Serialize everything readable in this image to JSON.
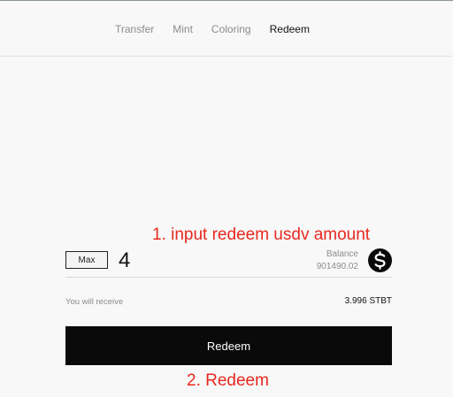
{
  "nav": {
    "items": [
      {
        "label": "Transfer",
        "active": false
      },
      {
        "label": "Mint",
        "active": false
      },
      {
        "label": "Coloring",
        "active": false
      },
      {
        "label": "Redeem",
        "active": true
      }
    ]
  },
  "annotations": {
    "step1": "1. input redeem usdv amount",
    "step2": "2. Redeem",
    "color": "#e8281e"
  },
  "form": {
    "max_label": "Max",
    "amount_value": "4",
    "balance_label": "Balance",
    "balance_value": "901490.02",
    "token_icon": "dollar-coin-icon",
    "receive_label": "You will receive",
    "receive_value": "3.996 STBT",
    "submit_label": "Redeem"
  }
}
